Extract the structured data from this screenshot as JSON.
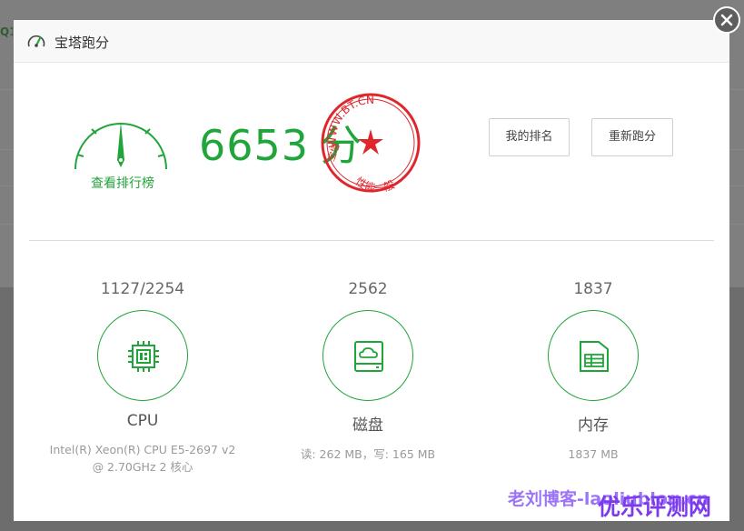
{
  "background": {
    "fragment_text": "Q1"
  },
  "dialog": {
    "title": "宝塔跑分",
    "close_icon": "close-icon"
  },
  "score": {
    "value": "6653",
    "unit": "分",
    "rank_link": "查看排行榜",
    "stamp": {
      "url": "WWW.BT.CN",
      "left": "宝塔",
      "bottom": "性能一般"
    }
  },
  "buttons": {
    "my_rank": "我的排名",
    "rerun": "重新跑分"
  },
  "metrics": [
    {
      "value": "1127/2254",
      "name": "CPU",
      "detail": "Intel(R) Xeon(R) CPU E5-2697 v2 @ 2.70GHz 2 核心",
      "icon": "cpu-chip-icon"
    },
    {
      "value": "2562",
      "name": "磁盘",
      "detail": "读: 262 MB，写: 165 MB",
      "icon": "disk-cloud-icon"
    },
    {
      "value": "1837",
      "name": "内存",
      "detail": "1837 MB",
      "icon": "memory-icon"
    }
  ],
  "watermarks": {
    "left": "老刘博客-laoliublog.cn",
    "right": "优乐评测网"
  },
  "colors": {
    "accent": "#20a53a",
    "stamp": "#e0262d",
    "overlay": "#7f7f7f"
  }
}
